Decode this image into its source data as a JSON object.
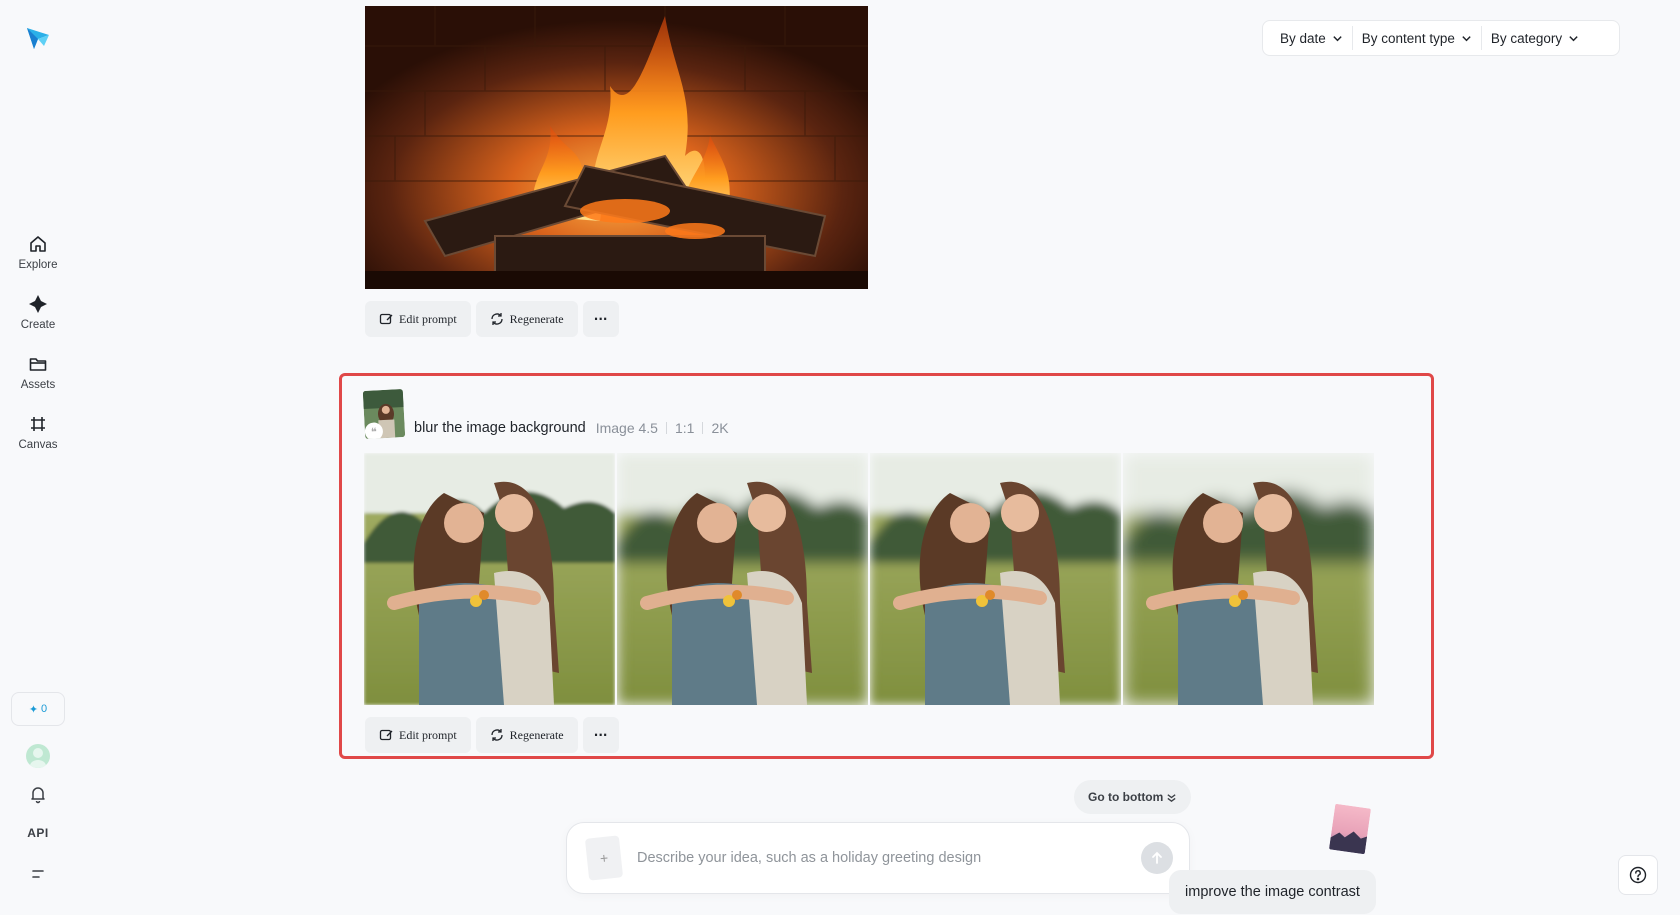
{
  "sidebar": {
    "items": [
      {
        "label": "Explore",
        "icon": "home-icon"
      },
      {
        "label": "Create",
        "icon": "sparkle-icon"
      },
      {
        "label": "Assets",
        "icon": "folder-icon"
      },
      {
        "label": "Canvas",
        "icon": "canvas-icon"
      }
    ],
    "credits": "0",
    "api_label": "API"
  },
  "filters": {
    "date": "By date",
    "content_type": "By content type",
    "category": "By category"
  },
  "generation_1": {
    "actions": {
      "edit": "Edit prompt",
      "regenerate": "Regenerate",
      "more": "···"
    }
  },
  "generation_2": {
    "prompt": "blur the image background",
    "model": "Image 4.5",
    "ratio": "1:1",
    "resolution": "2K",
    "image_count": 4,
    "actions": {
      "edit": "Edit prompt",
      "regenerate": "Regenerate",
      "more": "···"
    }
  },
  "go_bottom_label": "Go to bottom",
  "composer": {
    "placeholder": "Describe your idea, such as a holiday greeting design",
    "attach_label": "+"
  },
  "user_message": "improve the image contrast",
  "colors": {
    "accent": "#1a9ad6",
    "highlight_border": "#e04848",
    "background": "#f8f9fb"
  }
}
